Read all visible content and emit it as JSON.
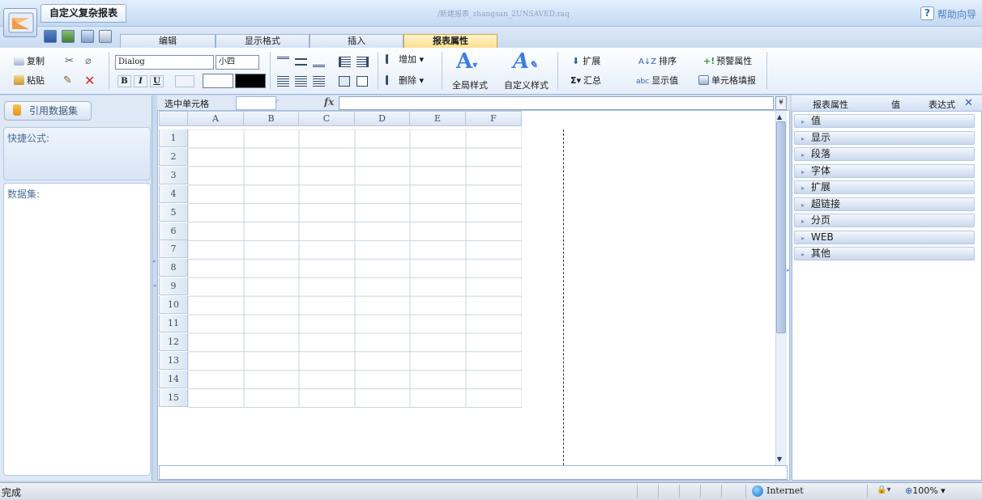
{
  "app": {
    "tab_title": "自定义复杂报表",
    "file_path": "/新建报表_zhangsan_2UNSAVED.raq",
    "help_label": "帮助向导"
  },
  "ribbon_tabs": [
    "编辑",
    "显示格式",
    "插入",
    "报表属性"
  ],
  "ribbon": {
    "copy": "复制",
    "paste": "粘贴",
    "font_name": "Dialog",
    "font_size": "小四",
    "bold": "B",
    "italic": "I",
    "underline": "U",
    "add": "增加",
    "delete": "删除",
    "global_style": "全局样式",
    "custom_style": "自定义样式",
    "expand": "扩展",
    "sort": "排序",
    "alert_props": "预警属性",
    "summary": "汇总",
    "display_value": "显示值",
    "cell_fill": "单元格填报"
  },
  "left_panel": {
    "ref_dataset": "引用数据集",
    "quick_formula": "快捷公式:",
    "dataset": "数据集:"
  },
  "formula_bar": {
    "selected_cell_label": "选中单元格",
    "cell_value": "",
    "fx": "fx"
  },
  "grid": {
    "columns": [
      "A",
      "B",
      "C",
      "D",
      "E",
      "F"
    ],
    "rows": [
      "1",
      "2",
      "3",
      "4",
      "5",
      "6",
      "7",
      "8",
      "9",
      "10",
      "11",
      "12",
      "13",
      "14",
      "15"
    ]
  },
  "right_panel": {
    "headers": [
      "报表属性",
      "值",
      "表达式"
    ],
    "groups": [
      "值",
      "显示",
      "段落",
      "字体",
      "扩展",
      "超链接",
      "分页",
      "WEB",
      "其他"
    ]
  },
  "status": {
    "left": "完成",
    "zone": "Internet",
    "zoom": "100%"
  },
  "colors": {
    "accent": "#f4b183",
    "active_tab": "#fddf8c"
  }
}
